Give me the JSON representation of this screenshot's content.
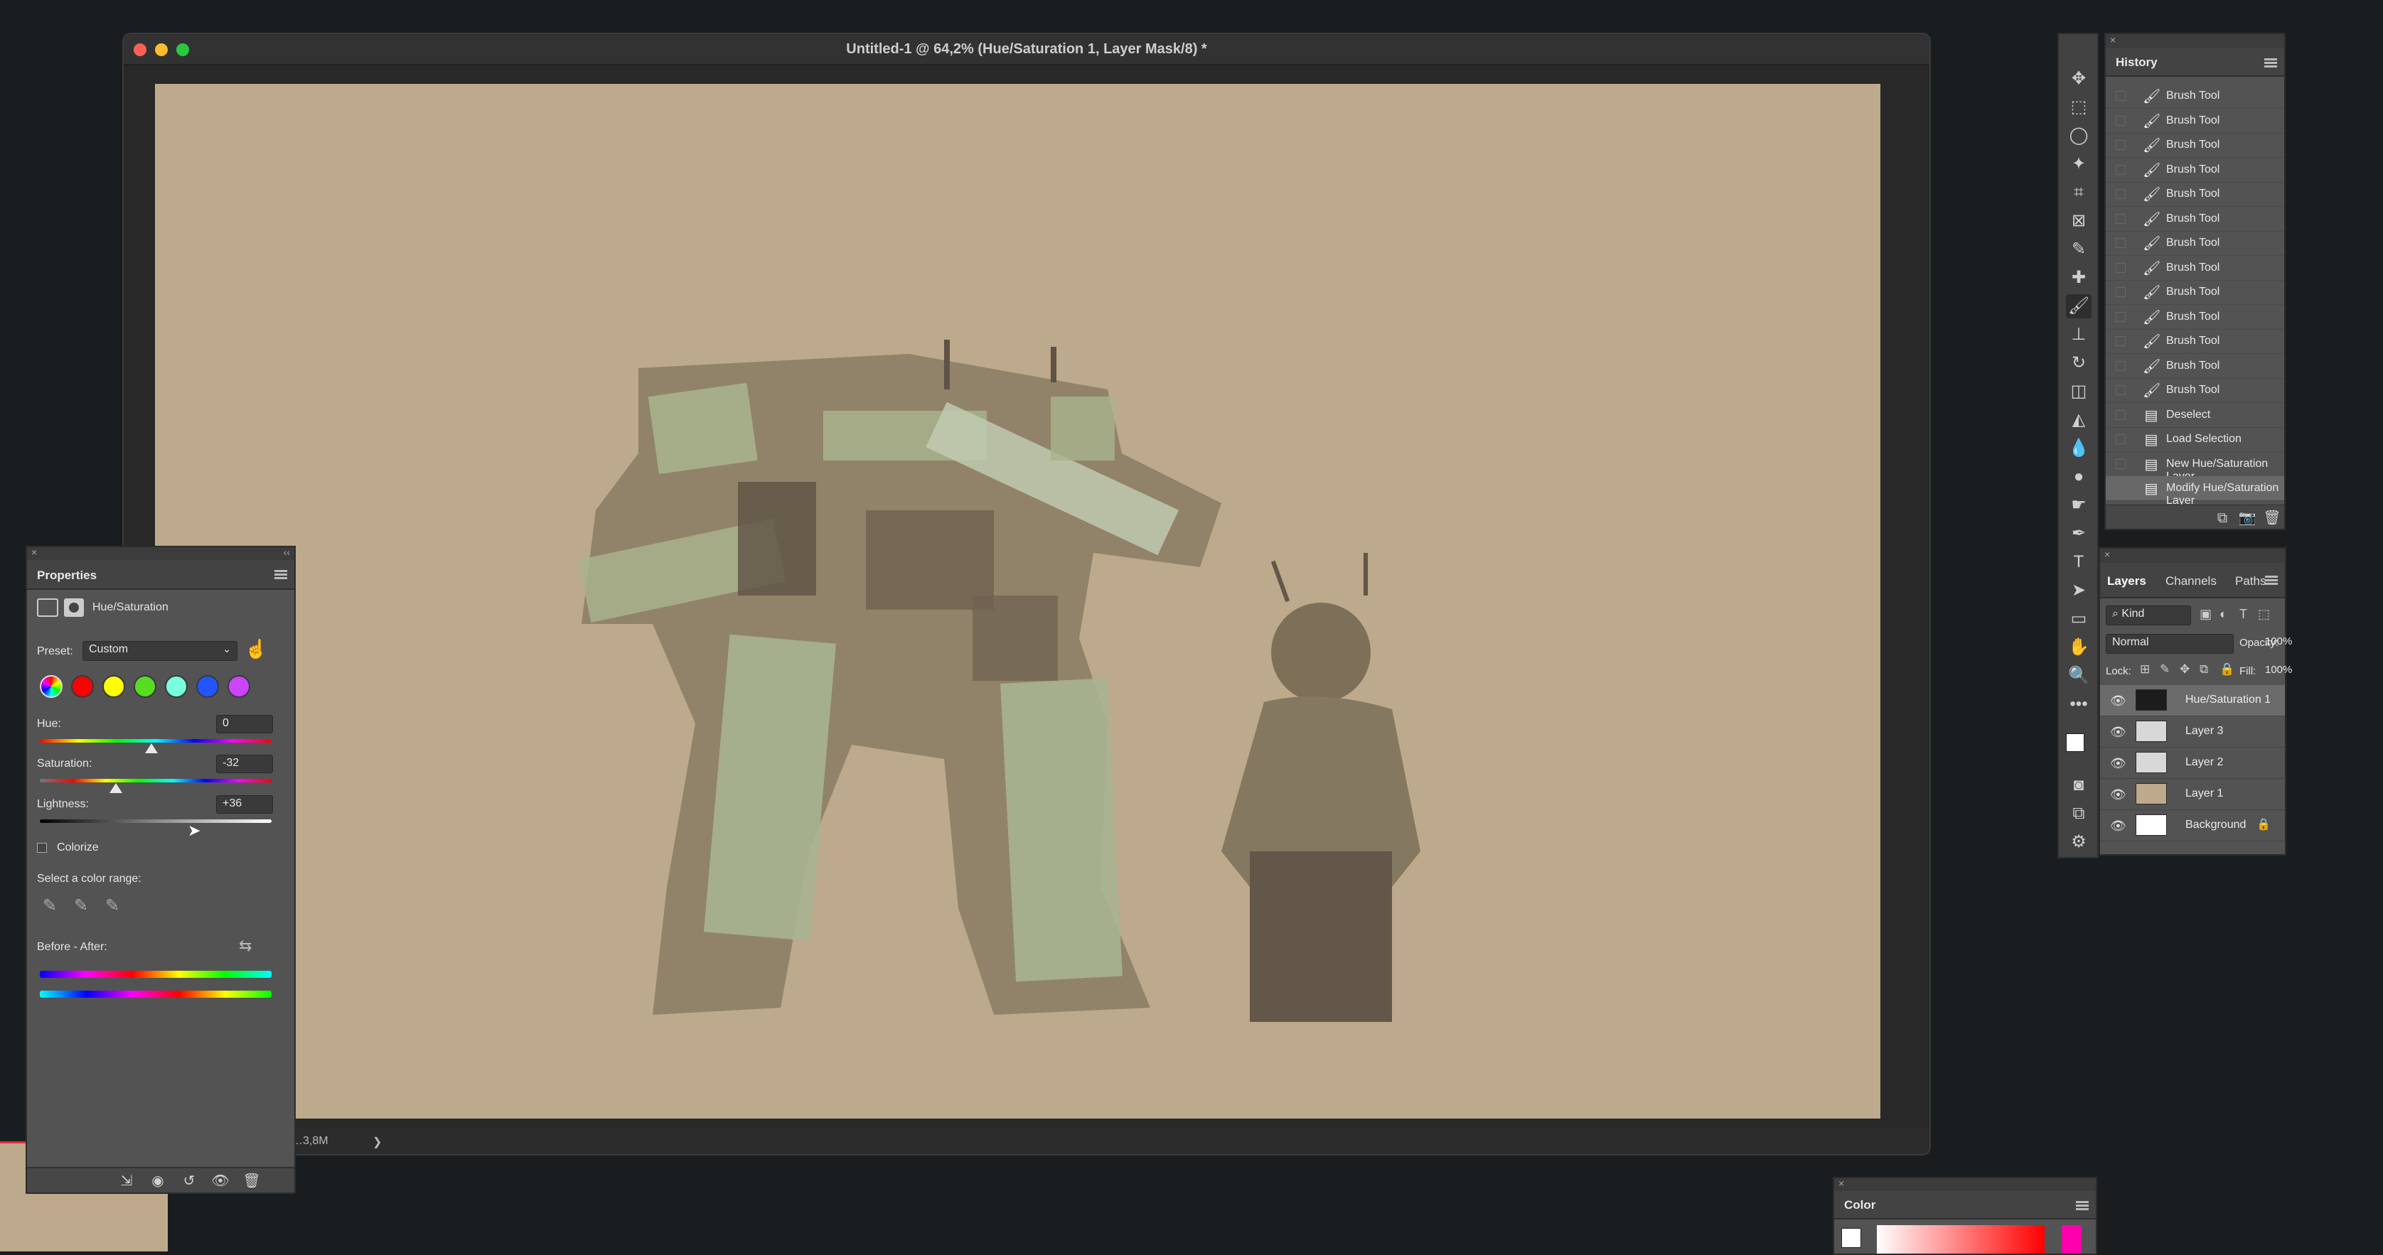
{
  "document": {
    "title": "Untitled-1 @ 64,2% (Hue/Saturation 1, Layer Mask/8) *",
    "status_text": "…3,8M",
    "status_arrow": "❯"
  },
  "properties": {
    "panel_title": "Properties",
    "adjustment_name": "Hue/Saturation",
    "preset_label": "Preset:",
    "preset_value": "Custom",
    "hue_label": "Hue:",
    "hue_value": "0",
    "saturation_label": "Saturation:",
    "saturation_value": "-32",
    "lightness_label": "Lightness:",
    "lightness_value": "+36",
    "colorize_label": "Colorize",
    "color_range_label": "Select a color range:",
    "before_after_label": "Before - After:",
    "swatches": [
      "#ff0000",
      "#ffff00",
      "#55dd22",
      "#77ffdd",
      "#2255ff",
      "#cc44ff"
    ]
  },
  "history": {
    "panel_title": "History",
    "items": [
      {
        "label": "Brush Tool",
        "icon": "brush-icon"
      },
      {
        "label": "Brush Tool",
        "icon": "brush-icon"
      },
      {
        "label": "Brush Tool",
        "icon": "brush-icon"
      },
      {
        "label": "Brush Tool",
        "icon": "brush-icon"
      },
      {
        "label": "Brush Tool",
        "icon": "brush-icon"
      },
      {
        "label": "Brush Tool",
        "icon": "brush-icon"
      },
      {
        "label": "Brush Tool",
        "icon": "brush-icon"
      },
      {
        "label": "Brush Tool",
        "icon": "brush-icon"
      },
      {
        "label": "Brush Tool",
        "icon": "brush-icon"
      },
      {
        "label": "Brush Tool",
        "icon": "brush-icon"
      },
      {
        "label": "Brush Tool",
        "icon": "brush-icon"
      },
      {
        "label": "Brush Tool",
        "icon": "brush-icon"
      },
      {
        "label": "Brush Tool",
        "icon": "brush-icon"
      },
      {
        "label": "Deselect",
        "icon": "document-icon"
      },
      {
        "label": "Load Selection",
        "icon": "document-icon"
      },
      {
        "label": "New Hue/Saturation Layer",
        "icon": "document-icon"
      },
      {
        "label": "Modify Hue/Saturation Layer",
        "icon": "document-icon"
      }
    ]
  },
  "layers": {
    "tabs": [
      "Layers",
      "Channels",
      "Paths"
    ],
    "kind_label": "Kind",
    "blend_mode": "Normal",
    "opacity_label": "Opacity:",
    "opacity_value": "100%",
    "lock_label": "Lock:",
    "fill_label": "Fill:",
    "fill_value": "100%",
    "items": [
      {
        "name": "Hue/Saturation 1",
        "active": true
      },
      {
        "name": "Layer 3"
      },
      {
        "name": "Layer 2"
      },
      {
        "name": "Layer 1"
      },
      {
        "name": "Background",
        "locked": true
      }
    ]
  },
  "color_panel": {
    "title": "Color"
  }
}
